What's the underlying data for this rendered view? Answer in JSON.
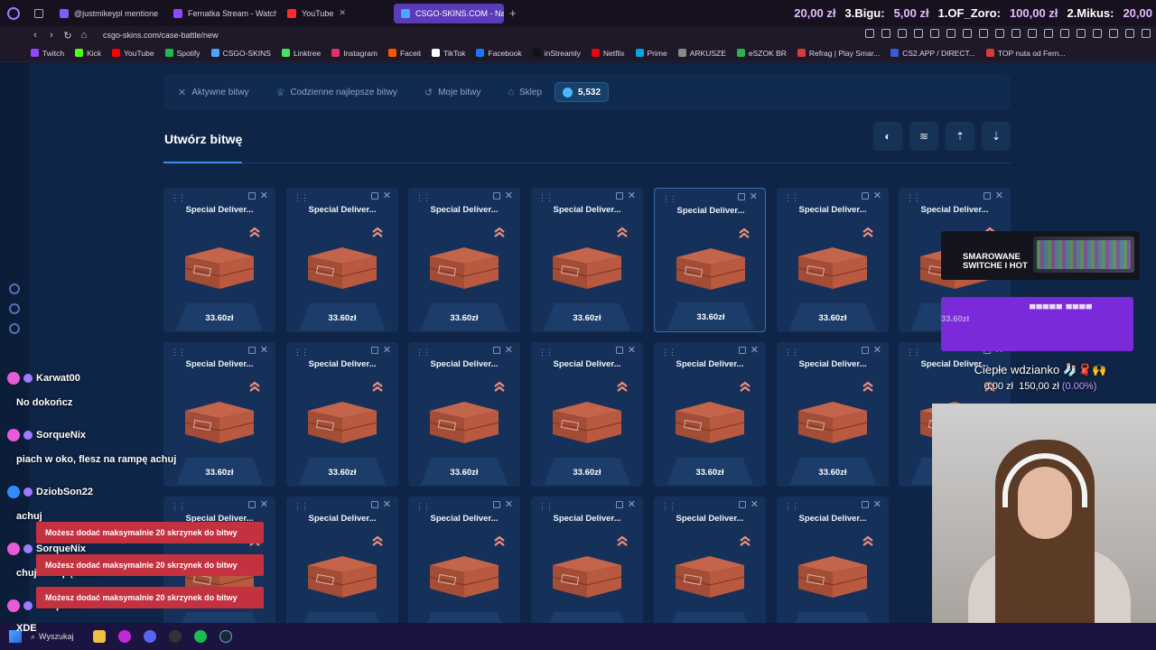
{
  "browser": {
    "tabs": [
      {
        "label": "@justmikeypl mentione",
        "fav": "#7d5cff"
      },
      {
        "label": "Fernatka Stream - Watch L",
        "fav": "#9146ff"
      },
      {
        "label": "YouTube",
        "fav": "#ff2b2b"
      },
      {
        "label": "CSGO-SKINS.COM - Najle",
        "fav": "#4aa7ff",
        "active": true
      }
    ],
    "ticker": [
      {
        "a": "20,00 zł",
        "b": "3.Bigu:"
      },
      {
        "a": "5,00 zł",
        "b": "1.OF_Zoro:"
      },
      {
        "a": "100,00 zł",
        "b": "2.Mikus:"
      },
      {
        "a": "20,00",
        "b": ""
      }
    ],
    "url": "csgo-skins.com/case-battle/new",
    "bookmarks": [
      {
        "label": "Twitch",
        "color": "#9146ff"
      },
      {
        "label": "Kick",
        "color": "#53fc18"
      },
      {
        "label": "YouTube",
        "color": "#ff0000"
      },
      {
        "label": "Spotify",
        "color": "#1db954"
      },
      {
        "label": "CSGO-SKINS",
        "color": "#4aa7ff"
      },
      {
        "label": "Linktree",
        "color": "#43e55e"
      },
      {
        "label": "Instagram",
        "color": "#e1306c"
      },
      {
        "label": "Faceit",
        "color": "#ff5500"
      },
      {
        "label": "TikTok",
        "color": "#ffffff"
      },
      {
        "label": "Facebook",
        "color": "#1877f2"
      },
      {
        "label": "inStreamly",
        "color": "#111111"
      },
      {
        "label": "Netflix",
        "color": "#e50914"
      },
      {
        "label": "Prime",
        "color": "#00a8e1"
      },
      {
        "label": "ARKUSZE",
        "color": "#888888"
      },
      {
        "label": "eSZOK BR",
        "color": "#2bb24c"
      },
      {
        "label": "Refrag | Play Smar...",
        "color": "#d93a3a"
      },
      {
        "label": "CS2.APP / DIRECT...",
        "color": "#3a5bd9"
      },
      {
        "label": "TOP nuta od Fern...",
        "color": "#d93a3a"
      }
    ]
  },
  "site": {
    "nav": [
      {
        "label": "Aktywne bitwy",
        "icon": "swords-icon"
      },
      {
        "label": "Codzienne najlepsze bitwy",
        "icon": "trophy-icon"
      },
      {
        "label": "Moje bitwy",
        "icon": "history-icon"
      },
      {
        "label": "Sklep",
        "icon": "shop-icon"
      }
    ],
    "balance": "5,532",
    "title": "Utwórz bitwę"
  },
  "cards": {
    "name": "Special Deliver...",
    "price": "33.60zł",
    "full_rows": 2,
    "cols": 7,
    "row3_cols": 6
  },
  "chat": {
    "messages": [
      {
        "user": "Karwat00",
        "text": "No dokończ",
        "badge": "#e85bd8"
      },
      {
        "user": "SorqueNix",
        "text": "piach w oko, flesz na rampę achuj",
        "badge": "#e85bd8"
      },
      {
        "user": "DziobSon22",
        "text": "achuj",
        "badge": "#2f8cff"
      },
      {
        "user": "SorqueNix",
        "text": "chuj w dupę także",
        "badge": "#e85bd8"
      },
      {
        "user": "SorqueNix",
        "text": "",
        "badge": "#e85bd8"
      }
    ],
    "toast": "Możesz dodać maksymalnie 20 skrzynek do bitwy"
  },
  "overlay": {
    "ad_text_1": "SMAROWANE",
    "ad_text_2": "SWITCHE I HOT",
    "purple_price": "33.60zł",
    "goal_title": "Ciepłe wdzianko",
    "goal_current": "0,00 zł",
    "goal_target": "150,00 zł",
    "goal_pct": "(0.00%)"
  },
  "taskbar": {
    "search_label": "Wyszukaj",
    "xde": "XDE"
  }
}
